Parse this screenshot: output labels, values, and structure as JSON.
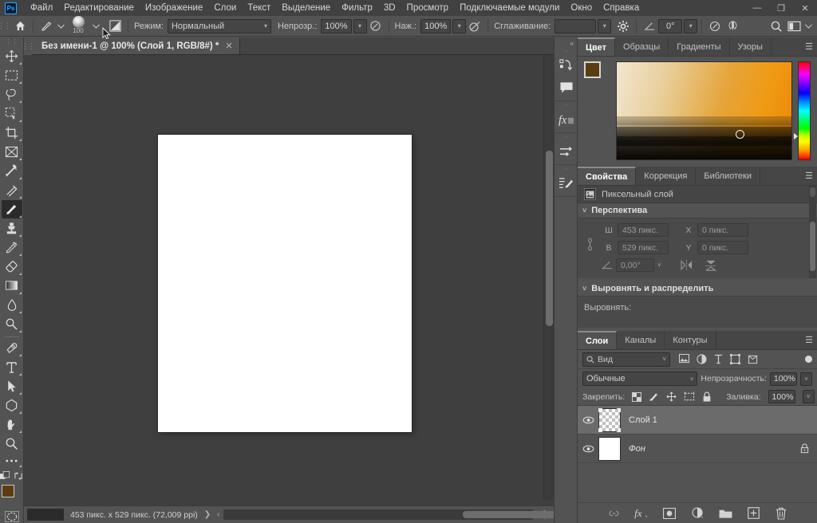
{
  "app": {
    "name": "Adobe Photoshop",
    "logo_text": "Ps"
  },
  "menubar": {
    "items": [
      {
        "label": "Файл"
      },
      {
        "label": "Редактирование"
      },
      {
        "label": "Изображение"
      },
      {
        "label": "Слои"
      },
      {
        "label": "Текст"
      },
      {
        "label": "Выделение"
      },
      {
        "label": "Фильтр"
      },
      {
        "label": "3D"
      },
      {
        "label": "Просмотр"
      },
      {
        "label": "Подключаемые модули"
      },
      {
        "label": "Окно"
      },
      {
        "label": "Справка"
      }
    ],
    "window_buttons": {
      "minimize": "—",
      "maximize": "❐",
      "close": "✕"
    }
  },
  "options_bar": {
    "home_icon": "home-icon",
    "brush_tool_icon": "brush-icon",
    "brush_size": "100",
    "mode_label": "Режим:",
    "mode_value": "Нормальный",
    "opacity_label": "Непрозр.:",
    "opacity_value": "100%",
    "flow_label": "Наж.:",
    "flow_value": "100%",
    "smoothing_label": "Сглаживание:",
    "smoothing_value": "",
    "angle_value": "0°",
    "settings_icon": "gear-icon",
    "airbrush_icon": "airbrush-icon",
    "symmetry_icon": "symmetry-butterfly-icon",
    "search_icon": "search-icon",
    "workspace_icon": "workspace-icon"
  },
  "toolbar": {
    "tools": [
      {
        "name": "move-tool",
        "icon": "move"
      },
      {
        "name": "marquee-tool",
        "icon": "marquee"
      },
      {
        "name": "lasso-tool",
        "icon": "lasso"
      },
      {
        "name": "quick-selection-tool",
        "icon": "quickselect"
      },
      {
        "name": "crop-tool",
        "icon": "crop"
      },
      {
        "name": "frame-tool",
        "icon": "frame"
      },
      {
        "name": "eyedropper-tool",
        "icon": "eyedropper"
      },
      {
        "name": "healing-brush-tool",
        "icon": "healing"
      },
      {
        "name": "brush-tool",
        "icon": "brush",
        "active": true
      },
      {
        "name": "clone-stamp-tool",
        "icon": "stamp"
      },
      {
        "name": "history-brush-tool",
        "icon": "historybrush"
      },
      {
        "name": "eraser-tool",
        "icon": "eraser"
      },
      {
        "name": "gradient-tool",
        "icon": "gradient"
      },
      {
        "name": "blur-tool",
        "icon": "blur"
      },
      {
        "name": "dodge-tool",
        "icon": "dodge"
      },
      {
        "name": "pen-tool",
        "icon": "pen"
      },
      {
        "name": "type-tool",
        "icon": "type"
      },
      {
        "name": "path-selection-tool",
        "icon": "pathselect"
      },
      {
        "name": "shape-tool",
        "icon": "shape"
      },
      {
        "name": "hand-tool",
        "icon": "hand"
      },
      {
        "name": "zoom-tool",
        "icon": "zoom"
      },
      {
        "name": "edit-toolbar-button",
        "icon": "ellipsis"
      }
    ],
    "foreground_color": "#5b3d12",
    "background_color": "#d8b27a",
    "quickmask_icon": "quick-mask-icon"
  },
  "document": {
    "tab_title": "Без имени-1 @ 100% (Слой 1, RGB/8#) *",
    "tab_close": "✕",
    "canvas_background": "#ffffff",
    "status_text": "453 пикс. x 529 пикс. (72,009 ppi)",
    "status_arrow": "❯",
    "status_arrow_left": "‹"
  },
  "rail": {
    "collapse_icon": "collapse-panels-icon",
    "buttons": [
      {
        "name": "actions-icon"
      },
      {
        "name": "notes-icon"
      },
      {
        "name": "layer-styles-fx-icon"
      },
      {
        "name": "adjustments-icon"
      },
      {
        "name": "brush-settings-icon"
      }
    ]
  },
  "color_panel": {
    "tabs": [
      {
        "label": "Цвет",
        "active": true
      },
      {
        "label": "Образцы",
        "active": false
      },
      {
        "label": "Градиенты",
        "active": false
      },
      {
        "label": "Узоры",
        "active": false
      }
    ],
    "menu_icon": "panel-menu-icon",
    "foreground_color": "#5b3d12",
    "background_color": "#d8b27a",
    "picker_type": "color-field-with-hue-strip"
  },
  "properties_panel": {
    "tabs": [
      {
        "label": "Свойства",
        "active": true
      },
      {
        "label": "Коррекция",
        "active": false
      },
      {
        "label": "Библиотеки",
        "active": false
      }
    ],
    "menu_icon": "panel-menu-icon",
    "layer_type": "Пиксельный слой",
    "layer_type_icon": "pixel-layer-icon",
    "perspective": {
      "title": "Перспектива",
      "width_label": "Ш",
      "width_value": "453 пикс.",
      "height_label": "В",
      "height_value": "529 пикс.",
      "x_label": "X",
      "x_value": "0 пикс.",
      "y_label": "Y",
      "y_value": "0 пикс.",
      "angle_value": "0,00°",
      "link_icon": "link-constrain-icon",
      "flip_h_icon": "flip-horizontal-icon",
      "flip_v_icon": "flip-vertical-icon"
    },
    "align": {
      "title": "Выровнять и распределить",
      "align_label": "Выровнять:"
    }
  },
  "layers_panel": {
    "tabs": [
      {
        "label": "Слои",
        "active": true
      },
      {
        "label": "Каналы",
        "active": false
      },
      {
        "label": "Контуры",
        "active": false
      }
    ],
    "menu_icon": "panel-menu-icon",
    "filter": {
      "search_icon": "search-icon",
      "kind_value": "Вид",
      "icons": [
        {
          "name": "filter-pixel-icon"
        },
        {
          "name": "filter-adjustment-icon"
        },
        {
          "name": "filter-type-icon"
        },
        {
          "name": "filter-shape-icon"
        },
        {
          "name": "filter-smart-object-icon"
        }
      ],
      "toggle_name": "filter-enable-toggle"
    },
    "blend_mode": "Обычные",
    "opacity_label": "Непрозрачность:",
    "opacity_value": "100%",
    "lock_label": "Закрепить:",
    "lock_icons": [
      {
        "name": "lock-transparent-pixels-icon"
      },
      {
        "name": "lock-image-pixels-icon"
      },
      {
        "name": "lock-position-icon"
      },
      {
        "name": "lock-artboard-icon"
      },
      {
        "name": "lock-all-icon"
      }
    ],
    "fill_label": "Заливка:",
    "fill_value": "100%",
    "layers": [
      {
        "name": "Слой 1",
        "visible": true,
        "selected": true,
        "thumb_type": "transparent",
        "locked": false
      },
      {
        "name": "Фон",
        "visible": true,
        "selected": false,
        "thumb_type": "white",
        "locked": true
      }
    ],
    "bottom_buttons": [
      {
        "name": "link-layers-icon"
      },
      {
        "name": "layer-style-fx-icon"
      },
      {
        "name": "add-layer-mask-icon"
      },
      {
        "name": "new-adjustment-layer-icon"
      },
      {
        "name": "new-group-icon"
      },
      {
        "name": "new-layer-icon"
      },
      {
        "name": "delete-layer-icon"
      }
    ]
  }
}
